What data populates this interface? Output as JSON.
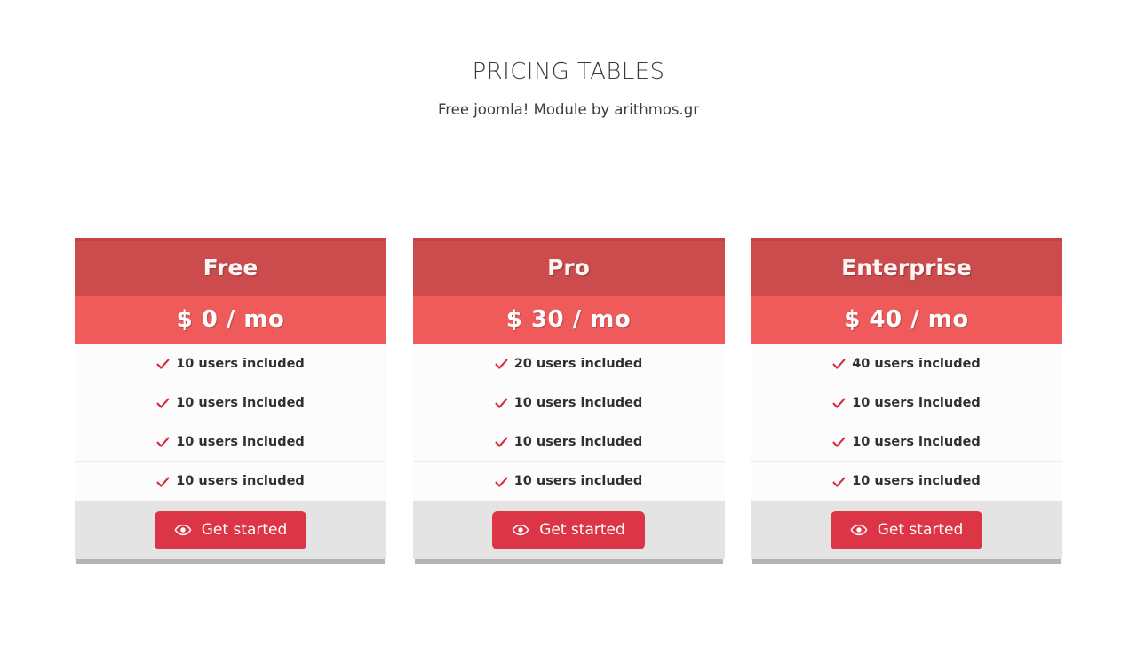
{
  "header": {
    "title": "PRICING TABLES",
    "subtitle": "Free joomla! Module by arithmos.gr"
  },
  "colors": {
    "head_bg": "#cc4b4c",
    "head_top_strip": "#c04243",
    "price_bg": "#ef5a5b",
    "button_bg": "#dc3545",
    "check": "#d7283c",
    "footer_bg": "#e4e4e4",
    "shadow_bar": "#b4b4b4",
    "feature_bg": "#fcfcfc",
    "separator": "#ececec"
  },
  "plans": [
    {
      "name": "Free",
      "price": "$ 0 / mo",
      "features": [
        "10 users included",
        "10 users included",
        "10 users included",
        "10 users included"
      ],
      "cta_label": "Get started",
      "cta_icon": "eye-icon",
      "check_icon": "check-icon"
    },
    {
      "name": "Pro",
      "price": "$ 30 / mo",
      "features": [
        "20 users included",
        "10 users included",
        "10 users included",
        "10 users included"
      ],
      "cta_label": "Get started",
      "cta_icon": "eye-icon",
      "check_icon": "check-icon"
    },
    {
      "name": "Enterprise",
      "price": "$ 40 / mo",
      "features": [
        "40 users included",
        "10 users included",
        "10 users included",
        "10 users included"
      ],
      "cta_label": "Get started",
      "cta_icon": "eye-icon",
      "check_icon": "check-icon"
    }
  ]
}
